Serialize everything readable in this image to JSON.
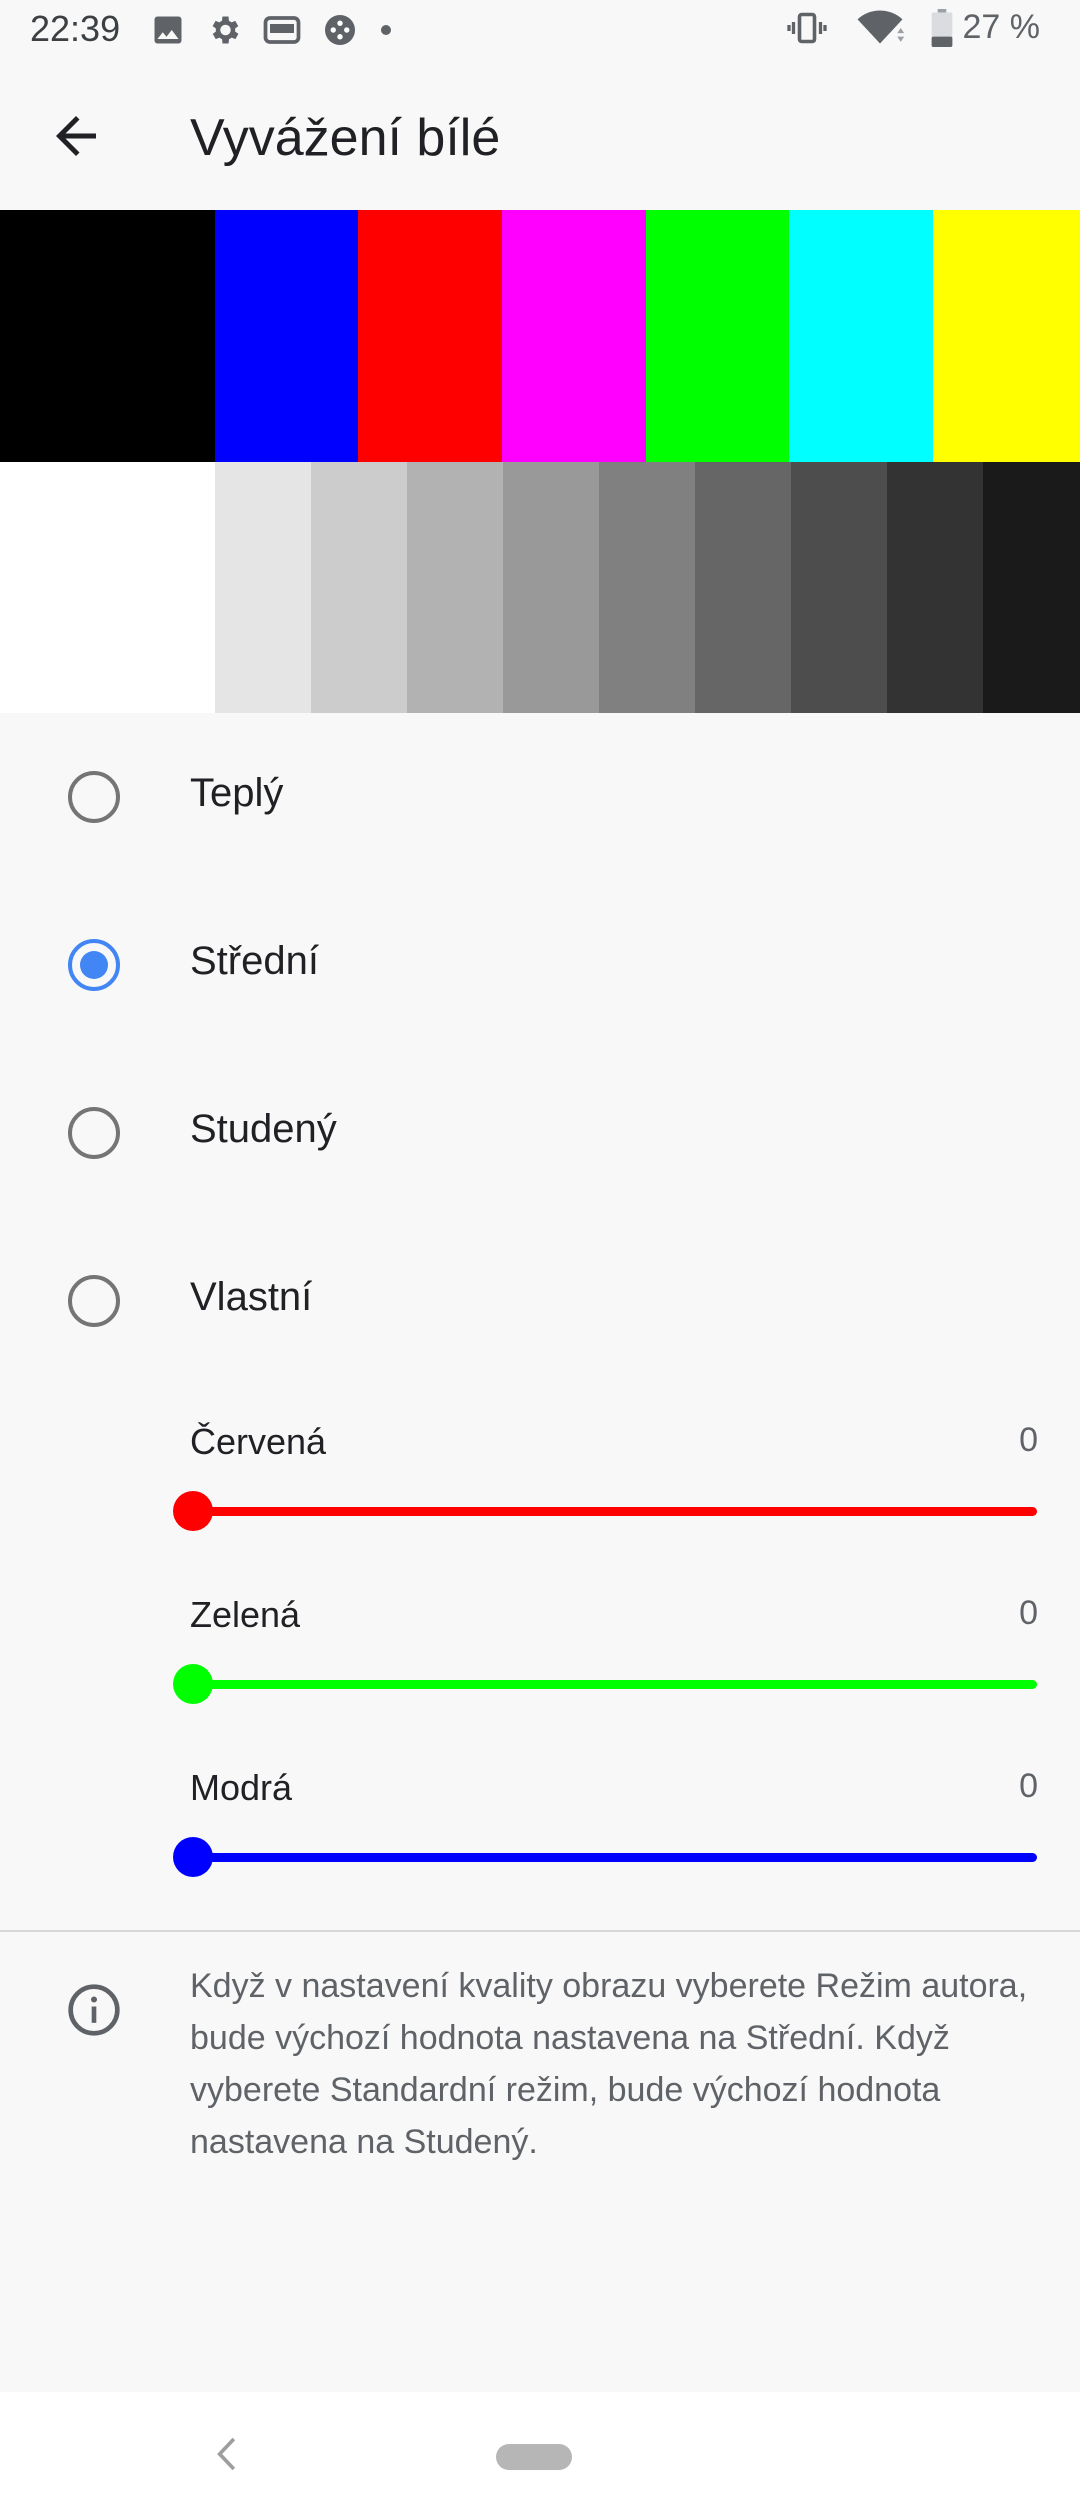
{
  "status_bar": {
    "time": "22:39",
    "left_icons": [
      "image-icon",
      "gear-icon",
      "card-icon",
      "gamepad-icon",
      "dot-icon"
    ],
    "right_icons": [
      "vibrate-icon",
      "wifi-icon",
      "battery-icon"
    ],
    "battery": "27 %"
  },
  "app_bar": {
    "title": "Vyvážení bílé",
    "back_icon": "arrow-back-icon"
  },
  "color_bars": {
    "top": [
      "#000000",
      "#0000ff",
      "#ff0000",
      "#ff00ff",
      "#00ff00",
      "#00ffff",
      "#ffff00"
    ],
    "bottom": [
      "#ffffff",
      "#e5e5e5",
      "#cccccc",
      "#b2b2b2",
      "#999999",
      "#808080",
      "#666666",
      "#4d4d4d",
      "#333333",
      "#1a1a1a"
    ]
  },
  "options": [
    {
      "label": "Teplý",
      "checked": false
    },
    {
      "label": "Střední",
      "checked": true
    },
    {
      "label": "Studený",
      "checked": false
    },
    {
      "label": "Vlastní",
      "checked": false
    }
  ],
  "sliders": [
    {
      "label": "Červená",
      "value": "0",
      "color": "#ff0000"
    },
    {
      "label": "Zelená",
      "value": "0",
      "color": "#00ff00"
    },
    {
      "label": "Modrá",
      "value": "0",
      "color": "#0000ff"
    }
  ],
  "info": {
    "icon": "info-icon",
    "text": "Když v nastavení kvality obrazu vyberete Režim autora, bude výchozí hodnota nastavena na Střední. Když vyberete Standardní režim, bude výchozí hodnota nastavena na Studený."
  },
  "nav_bar": {
    "back_icon": "nav-back-icon",
    "home_icon": "home-pill-icon"
  },
  "colors": {
    "accent": "#4285f4",
    "background": "#f8f8f8"
  }
}
